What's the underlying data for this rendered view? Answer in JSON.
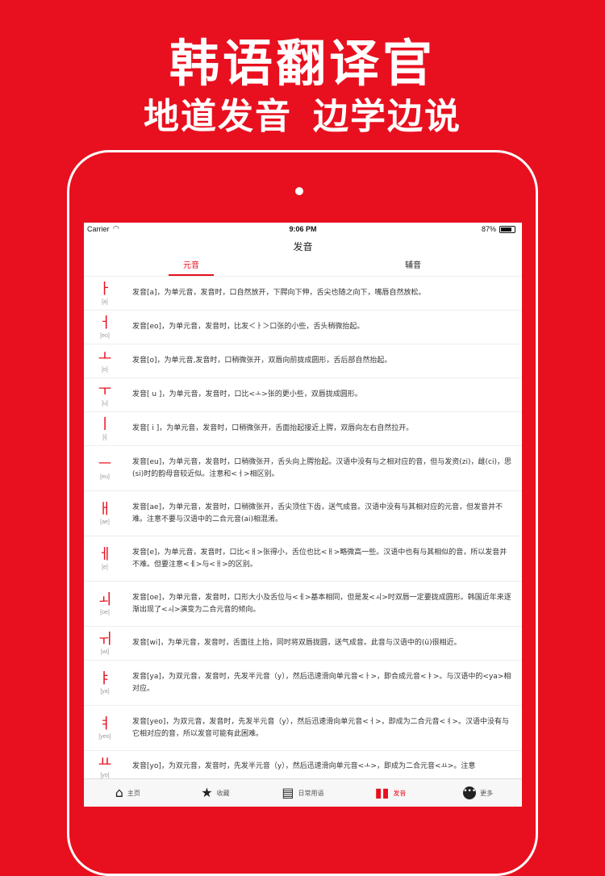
{
  "headline": "韩语翻译官",
  "subline_left": "地道发音",
  "subline_right": "边学边说",
  "status": {
    "carrier": "Carrier",
    "time": "9:06 PM",
    "battery": "87%"
  },
  "nav_title": "发音",
  "segments": {
    "vowel": "元音",
    "consonant": "辅音"
  },
  "rows": [
    {
      "char": "ㅏ",
      "roman": "[a]",
      "desc": "发音[a]，为单元音，发音时，口自然放开，下腭向下伸，舌尖也随之向下，嘴唇自然放松。"
    },
    {
      "char": "ㅓ",
      "roman": "[eo]",
      "desc": "发音[eo]，为单元音，发音时，比发＜ㅏ＞口张的小些，舌头稍微抬起。"
    },
    {
      "char": "ㅗ",
      "roman": "[o]",
      "desc": "发音[o]，为单元音,发音时，口稍微张开，双唇向前拢成圆形，舌后部自然抬起。"
    },
    {
      "char": "ㅜ",
      "roman": "[u]",
      "desc": "发音[ u ]，为单元音，发音时，口比<ㅗ>张的更小些，双唇拢成圆形。"
    },
    {
      "char": "ㅣ",
      "roman": "[i]",
      "desc": "发音[ i ]，为单元音，发音时，口稍微张开，舌面抬起接近上腭，双唇向左右自然拉开。"
    },
    {
      "char": "ㅡ",
      "roman": "[eu]",
      "desc": "发音[eu]，为单元音，发音时，口稍微张开，舌头向上腭抬起。汉语中没有与之相对应的音，但与发资(zi)，雌(ci)，思(si)时的韵母音较近似。注意和<ㅓ>相区别。"
    },
    {
      "char": "ㅐ",
      "roman": "[ae]",
      "desc": "发音[ae]，为单元音，发音时，口稍微张开，舌尖顶住下齿，送气成音。汉语中没有与其相对应的元音，但发音并不难。注意不要与汉语中的二合元音(ai)相混淆。"
    },
    {
      "char": "ㅔ",
      "roman": "[e]",
      "desc": "发音[e]，为单元音，发音时，口比<ㅐ>张得小，舌位也比<ㅐ>略微高一些。汉语中也有与其相似的音，所以发音并不难。但要注意<ㅔ>与<ㅐ>的区别。"
    },
    {
      "char": "ㅚ",
      "roman": "[oe]",
      "desc": "发音[oe]，为单元音，发音时，口形大小及舌位与<ㅔ>基本相同，但是发<ㅚ>时双唇一定要拢成圆形。韩国近年来逐渐出现了<ㅚ>演变为二合元音的倾向。"
    },
    {
      "char": "ㅟ",
      "roman": "[wi]",
      "desc": "发音[wi]，为单元音，发音时，舌面往上抬，同时将双唇拢圆，送气成音。此音与汉语中的(ü)很相近。"
    },
    {
      "char": "ㅑ",
      "roman": "[ya]",
      "desc": "发音[ya]，为双元音，发音时，先发半元音（y），然后迅速滑向单元音<ㅏ>，即合成元音<ㅑ>。与汉语中的<ya>相对应。"
    },
    {
      "char": "ㅕ",
      "roman": "[yeo]",
      "desc": "发音[yeo]，为双元音，发音时，先发半元音（y），然后迅速滑向单元音<ㅓ>，即成为二合元音<ㅕ>。汉语中没有与它相对应的音，所以发音可能有此困难。"
    },
    {
      "char": "ㅛ",
      "roman": "[yo]",
      "desc": "发音[yo]，为双元音，发音时，先发半元音（y），然后迅速滑向单元音<ㅗ>，即成为二合元音<ㅛ>。注意"
    }
  ],
  "tabs": [
    {
      "label": "主页",
      "icon": "home-icon",
      "glyph": "⌂"
    },
    {
      "label": "收藏",
      "icon": "star-icon",
      "glyph": "★"
    },
    {
      "label": "日常用语",
      "icon": "chat-icon",
      "glyph": "▤"
    },
    {
      "label": "发音",
      "icon": "book-icon",
      "glyph": "▮▮"
    },
    {
      "label": "更多",
      "icon": "more-icon",
      "glyph": "•••"
    }
  ],
  "accent_color": "#e8101f"
}
